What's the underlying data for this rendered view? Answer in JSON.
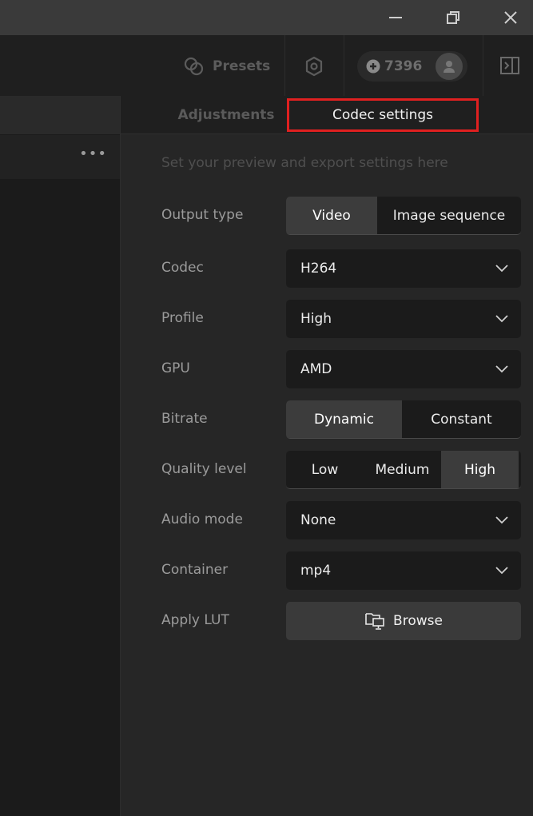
{
  "window": {
    "minimize_icon": "minimize-icon",
    "maximize_icon": "restore-icon",
    "close_icon": "close-icon"
  },
  "toolbar": {
    "presets_label": "Presets",
    "credits": "7396"
  },
  "left_panel": {
    "more_label": "•••"
  },
  "tabs": [
    {
      "label": "Adjustments",
      "active": false
    },
    {
      "label": "Codec settings",
      "active": true
    }
  ],
  "codec": {
    "subtitle": "Set your preview and export settings here",
    "output_type": {
      "label": "Output type",
      "options": [
        "Video",
        "Image sequence"
      ],
      "selected": "Video"
    },
    "codec": {
      "label": "Codec",
      "value": "H264"
    },
    "profile": {
      "label": "Profile",
      "value": "High"
    },
    "gpu": {
      "label": "GPU",
      "value": "AMD"
    },
    "bitrate": {
      "label": "Bitrate",
      "options": [
        "Dynamic",
        "Constant"
      ],
      "selected": "Dynamic"
    },
    "quality": {
      "label": "Quality level",
      "options": [
        "Low",
        "Medium",
        "High"
      ],
      "selected": "High"
    },
    "audio_mode": {
      "label": "Audio mode",
      "value": "None"
    },
    "container": {
      "label": "Container",
      "value": "mp4"
    },
    "apply_lut": {
      "label": "Apply LUT",
      "button": "Browse"
    }
  },
  "colors": {
    "highlight_border": "#e02020"
  }
}
